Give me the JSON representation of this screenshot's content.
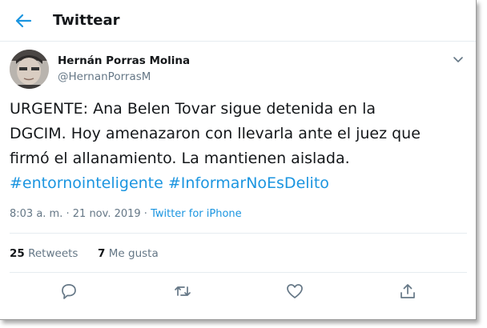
{
  "header": {
    "title": "Twittear"
  },
  "tweet": {
    "author_name": "Hernán Porras Molina",
    "author_handle": "@HernanPorrasM",
    "text_lines": [
      "URGENTE: Ana Belen Tovar sigue detenida en la",
      "DGCIM. Hoy amenazaron con llevarla ante el juez que",
      "firmó el allanamiento. La mantienen aislada."
    ],
    "hashtags": [
      "#entornointeligente",
      "#InformarNoEsDelito"
    ],
    "time": "8:03 a. m.",
    "separator": " · ",
    "date": "21 nov. 2019",
    "source": "Twitter for iPhone"
  },
  "stats": {
    "retweets_count": "25",
    "retweets_label": "Retweets",
    "likes_count": "7",
    "likes_label": "Me gusta"
  },
  "colors": {
    "accent": "#1b95e0",
    "muted": "#657786",
    "text": "#14171a",
    "divider": "#e6ecf0"
  },
  "icons": [
    "back-arrow-icon",
    "chevron-down-icon",
    "reply-icon",
    "retweet-icon",
    "like-icon",
    "share-icon"
  ]
}
